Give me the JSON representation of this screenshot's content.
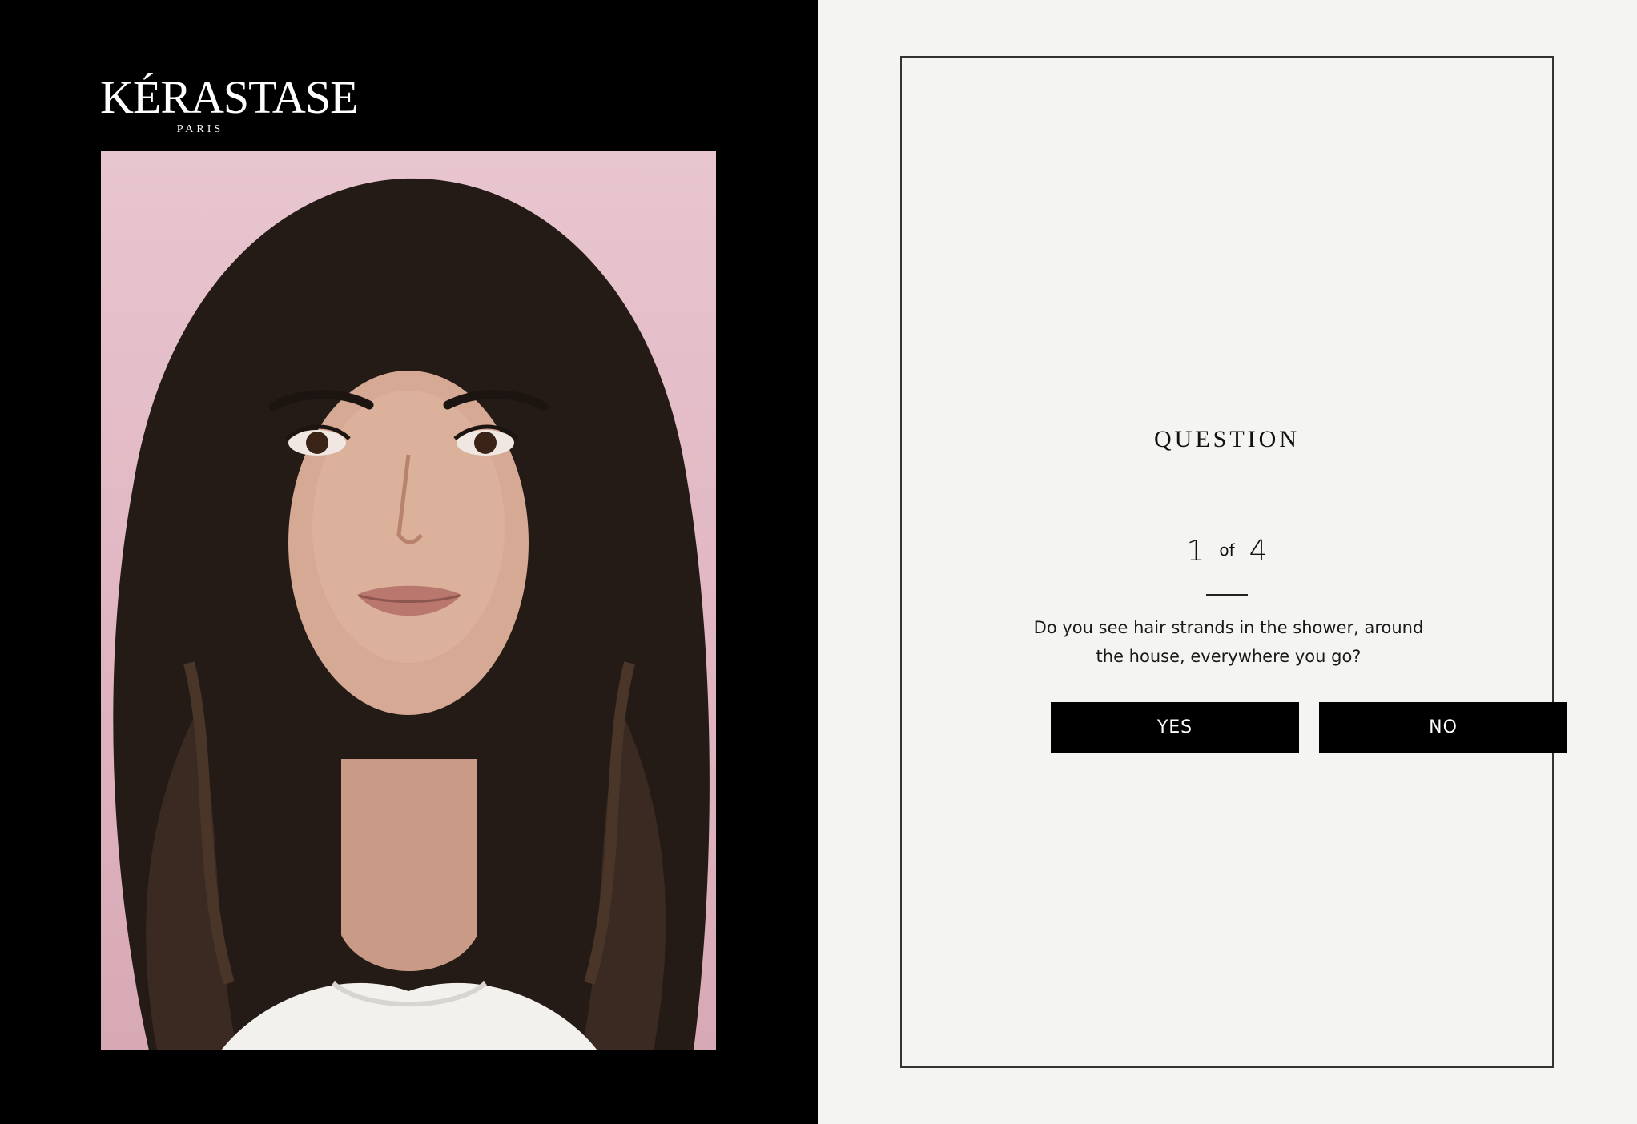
{
  "brand": {
    "name": "KÉRASTASE",
    "tagline": "PARIS"
  },
  "photo": {
    "description": "model portrait"
  },
  "quiz": {
    "heading": "QUESTION",
    "current": "1",
    "of_label": "of",
    "total": "4",
    "question": "Do you see hair strands in the shower, around the house, everywhere you go?",
    "yes_label": "YES",
    "no_label": "NO"
  },
  "colors": {
    "left_background": "#000000",
    "right_background": "#f4f4f3",
    "button_background": "#000000",
    "button_text": "#ffffff"
  }
}
